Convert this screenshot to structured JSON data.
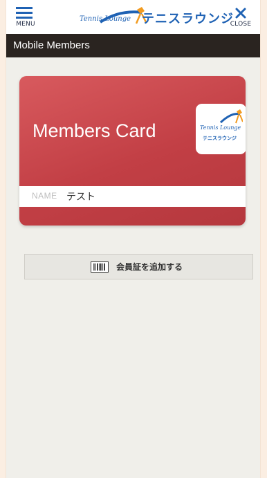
{
  "header": {
    "menu_label": "MENU",
    "close_label": "CLOSE",
    "logo_script": "Tennis Lounge",
    "logo_jp": "テニスラウンジ",
    "brand_color": "#1f62b4"
  },
  "subheader": {
    "title": "Mobile Members"
  },
  "card": {
    "title": "Members Card",
    "logo_script": "Tennis Lounge",
    "logo_jp": "テニスラウンジ",
    "name_label": "NAME",
    "name_value": "テスト",
    "color": "#c9474c"
  },
  "actions": {
    "add_card_label": "会員証を追加する",
    "add_card_icon": "barcode-icon"
  }
}
